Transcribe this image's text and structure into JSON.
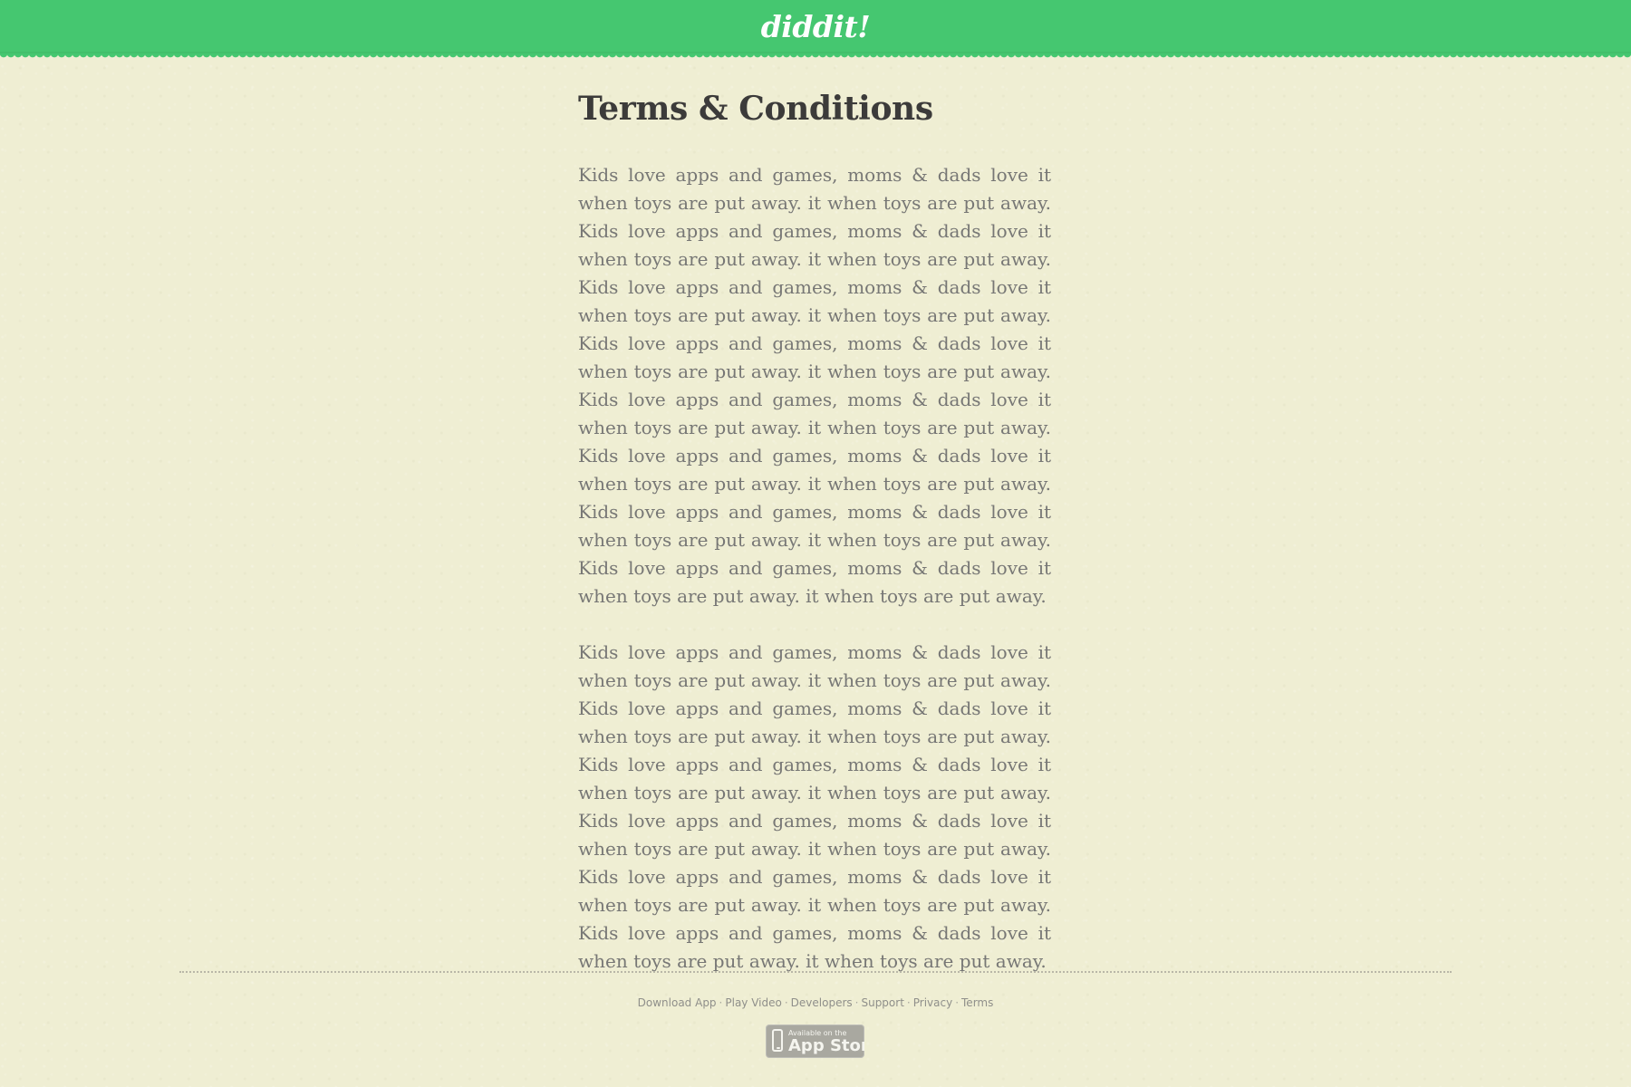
{
  "header": {
    "logo_text": "diddit!"
  },
  "page": {
    "title": "Terms & Conditions",
    "paragraphs": [
      "Kids love apps and games, moms & dads love it when toys are put away. it when toys are put away. Kids love apps and games, moms & dads love it when toys are put away. it when toys are put away. Kids love apps and games, moms & dads love it when toys are put away. it when toys are put away. Kids love apps and games, moms & dads love it when toys are put away. it when toys are put away. Kids love apps and games, moms & dads love it when toys are put away. it when toys are put away. Kids love apps and games, moms & dads love it when toys are put away. it when toys are put away. Kids love apps and games, moms & dads love it when toys are put away. it when toys are put away. Kids love apps and games, moms & dads love it when toys are put away. it when toys are put away.",
      "Kids love apps and games, moms & dads love it when toys are put away. it when toys are put away. Kids love apps and games, moms & dads love it when toys are put away. it when toys are put away. Kids love apps and games, moms & dads love it when toys are put away. it when toys are put away. Kids love apps and games, moms & dads love it when toys are put away. it when toys are put away. Kids love apps and games, moms & dads love it when toys are put away. it when toys are put away. Kids love apps and games, moms & dads love it when toys are put away. it when toys are put away."
    ]
  },
  "footer": {
    "links": [
      "Download App",
      "Play Video",
      "Developers",
      "Support",
      "Privacy",
      "Terms"
    ],
    "separator": "·",
    "app_store": {
      "small_text": "Available on the",
      "large_text": "App Store",
      "icon": "phone-icon"
    }
  },
  "colors": {
    "header_green": "#45c770",
    "background": "#efeed3",
    "title": "#3c3b3a",
    "body_text": "#777775",
    "footer_link": "#8f8f8a",
    "badge": "#a9a8a0"
  }
}
